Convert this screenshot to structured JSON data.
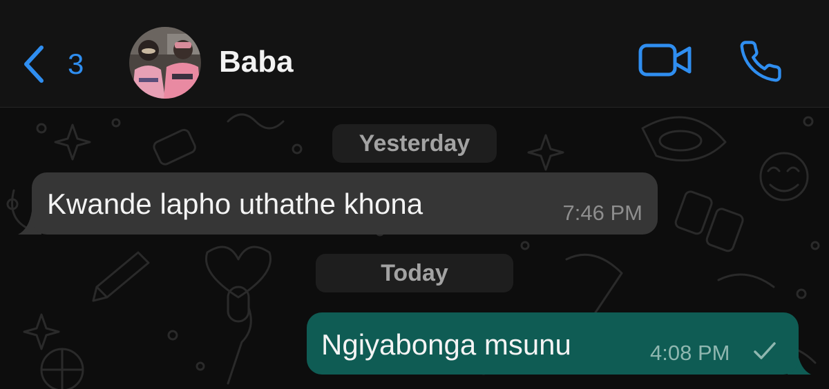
{
  "header": {
    "unread_count": "3",
    "contact_name": "Baba",
    "icons": {
      "back": "chevron-left-icon",
      "video": "video-camera-icon",
      "call": "phone-icon"
    }
  },
  "chat": {
    "date_separators": [
      "Yesterday",
      "Today"
    ],
    "messages": [
      {
        "direction": "incoming",
        "text": "Kwande lapho uthathe khona",
        "time": "7:46 PM"
      },
      {
        "direction": "outgoing",
        "text": "Ngiyabonga msunu",
        "time": "4:08 PM",
        "status": "sent"
      }
    ]
  },
  "colors": {
    "accent": "#2f8ef0",
    "header_bg": "#131313",
    "incoming_bubble": "#363636",
    "outgoing_bubble": "#0f5c54",
    "date_pill": "#1e1e1e"
  }
}
